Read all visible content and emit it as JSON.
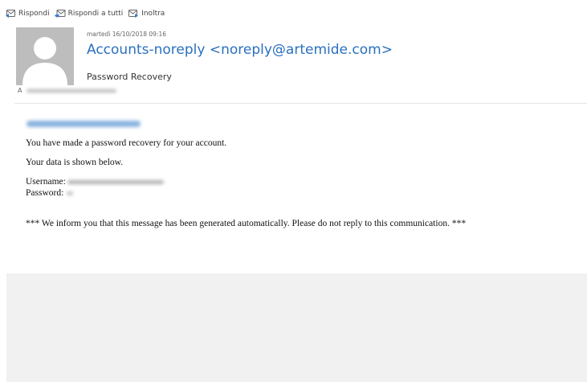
{
  "toolbar": {
    "reply_label": "Rispondi",
    "reply_all_label": "Rispondi a tutti",
    "forward_label": "Inoltra"
  },
  "header": {
    "date": "martedì 16/10/2018 09:16",
    "sender": "Accounts-noreply <noreply@artemide.com>",
    "subject": "Password Recovery",
    "to_label": "A"
  },
  "body": {
    "line1": "You have made a password recovery for your account.",
    "line2": "Your data is shown below.",
    "username_label": "Username:",
    "password_label": "Password:",
    "footer_note": "*** We inform you that this message has been generated automatically. Please do not reply to this communication. ***"
  },
  "colors": {
    "sender": "#2a70c0",
    "avatar": "#bdbdbd",
    "bottom_panel": "#f1f1f1"
  },
  "icons": {
    "reply": "reply-icon",
    "reply_all": "reply-all-icon",
    "forward": "forward-icon",
    "avatar": "user-silhouette-icon"
  }
}
